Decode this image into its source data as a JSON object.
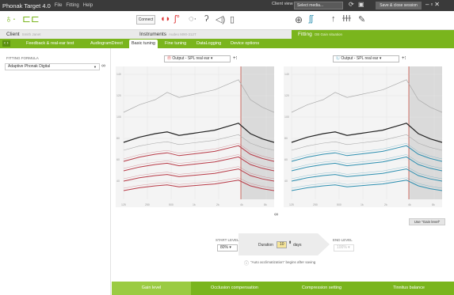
{
  "app": {
    "title": "Phonak Target 4.0",
    "menu": [
      "File",
      "Fitting",
      "Help"
    ]
  },
  "titlebar": {
    "client_view": "Client view",
    "source_select": "Select media...",
    "save_close": "Save & close session"
  },
  "toolbar": {
    "connect": "Connect"
  },
  "infobar": {
    "client_label": "Client",
    "client_name": "Smith Janet",
    "instruments_label": "Instruments",
    "instruments_sub": "Audeo M90-312T",
    "fitting_label": "Fitting",
    "fitting_sub": "OB Gain situation"
  },
  "tabs": [
    "Feedback & real-ear test",
    "AudiogramDirect",
    "Basic tuning",
    "Fine tuning",
    "DataLogging",
    "Device options"
  ],
  "left": {
    "formula_label": "FITTING FORMULA",
    "formula_value": "Adaptive Phonak Digital"
  },
  "charts": {
    "left": {
      "selector": "Output - SPL real ear",
      "color": "#b83a47"
    },
    "right": {
      "selector": "Output - SPL real ear",
      "color": "#2d8fb0"
    },
    "y_ticks": [
      "140",
      "120",
      "100",
      "80",
      "60",
      "40"
    ],
    "x_ticks": [
      "125",
      "250",
      "500",
      "1k",
      "2k",
      "4k",
      "8k"
    ]
  },
  "use_gain": "Use \"Gain level\"",
  "bottom": {
    "start_label": "START LEVEL",
    "start_value": "80%",
    "duration_label": "Duration",
    "duration_value": "10",
    "duration_unit": "days",
    "end_label": "END LEVEL",
    "end_value": "100%",
    "note": "\"Auto acclimatization\" begins after saving"
  },
  "bottomtabs": [
    "Gain level",
    "Occlusion compensation",
    "Compression setting",
    "Tinnitus balance"
  ]
}
